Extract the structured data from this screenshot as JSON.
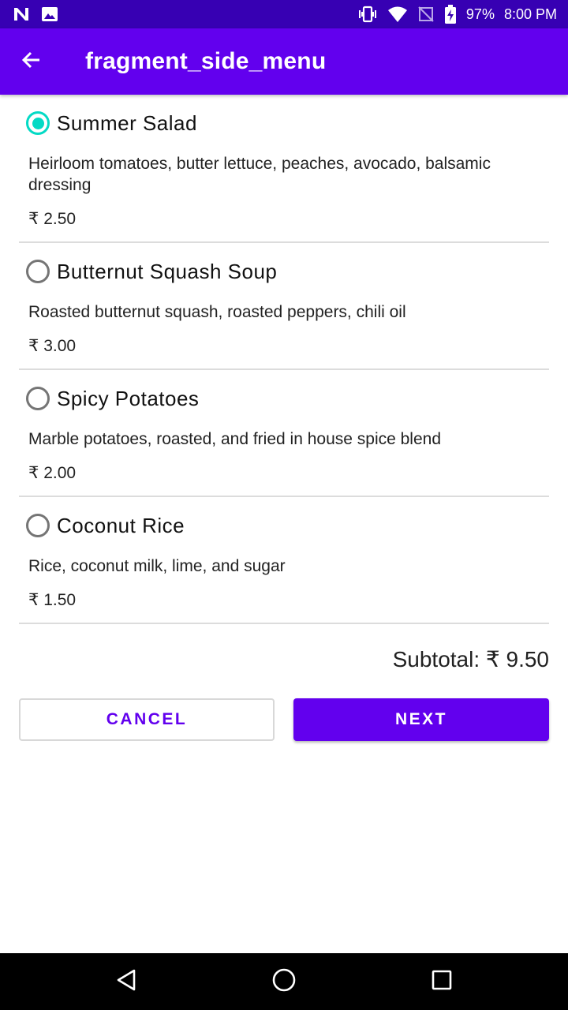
{
  "status_bar": {
    "battery": "97%",
    "time": "8:00 PM"
  },
  "app_bar": {
    "title": "fragment_side_menu"
  },
  "menu_items": [
    {
      "name": "Summer Salad",
      "description": "Heirloom tomatoes, butter lettuce, peaches, avocado, balsamic dressing",
      "price": "₹ 2.50",
      "selected": true
    },
    {
      "name": "Butternut Squash Soup",
      "description": "Roasted butternut squash, roasted peppers, chili oil",
      "price": "₹ 3.00",
      "selected": false
    },
    {
      "name": "Spicy Potatoes",
      "description": "Marble potatoes, roasted, and fried in house spice blend",
      "price": "₹ 2.00",
      "selected": false
    },
    {
      "name": "Coconut Rice",
      "description": "Rice, coconut milk, lime, and sugar",
      "price": "₹ 1.50",
      "selected": false
    }
  ],
  "subtotal": "Subtotal: ₹ 9.50",
  "buttons": {
    "cancel": "CANCEL",
    "next": "NEXT"
  },
  "colors": {
    "primary": "#6200ee",
    "primary_dark": "#3700b3",
    "accent": "#03dac5"
  },
  "icons": {
    "status_left": [
      "n-logo-icon",
      "image-notification-icon"
    ],
    "status_right": [
      "vibrate-icon",
      "wifi-icon",
      "no-sim-icon",
      "battery-charging-icon"
    ],
    "nav": [
      "back-triangle-icon",
      "home-circle-icon",
      "recents-square-icon"
    ]
  }
}
